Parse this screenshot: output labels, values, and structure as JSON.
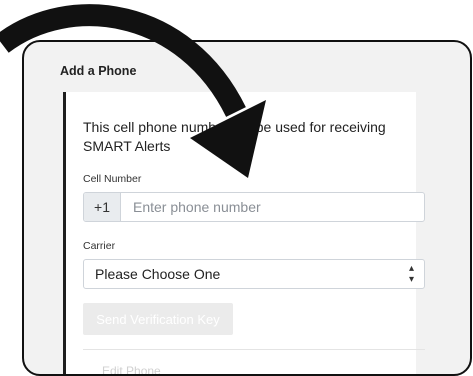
{
  "section": {
    "title": "Add a Phone"
  },
  "card": {
    "intro": "This cell phone number will be used for receiving SMART Alerts",
    "cell_label": "Cell Number",
    "country_code": "+1",
    "phone_placeholder": "Enter phone number",
    "carrier_label": "Carrier",
    "carrier_selected": "Please Choose One",
    "send_button": "Send Verification Key",
    "partial_text": "Edit Phone"
  },
  "icons": {
    "arrow": "curved-arrow-overlay",
    "select_caret": "up-down-caret-icon"
  },
  "colors": {
    "arrow": "#111111",
    "prefix_bg": "#e9ecef",
    "disabled_button": "#ebebeb"
  }
}
